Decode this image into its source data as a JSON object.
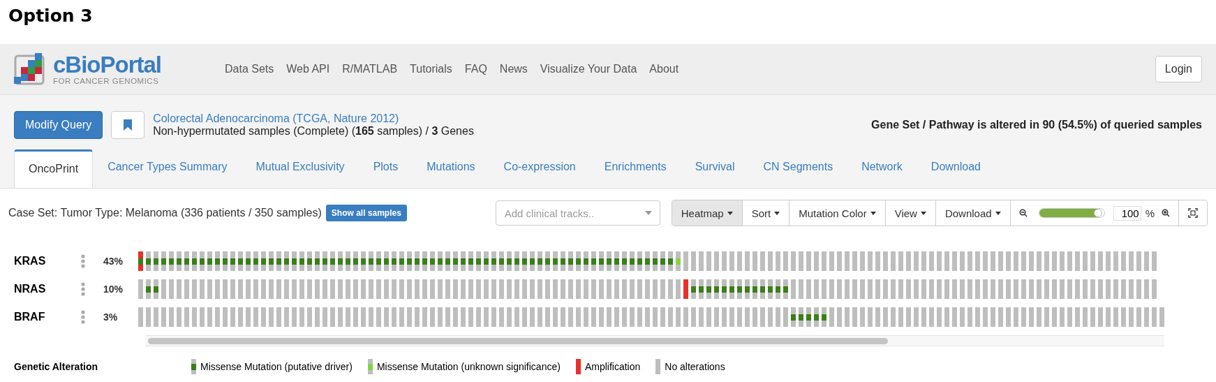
{
  "heading": "Option 3",
  "navbar": {
    "logo": {
      "name": "cBioPortal",
      "tagline": "FOR CANCER GENOMICS"
    },
    "links": [
      "Data Sets",
      "Web API",
      "R/MATLAB",
      "Tutorials",
      "FAQ",
      "News",
      "Visualize Your Data",
      "About"
    ],
    "login": "Login"
  },
  "query": {
    "modify_button": "Modify Query",
    "study": "Colorectal Adenocarcinoma (TCGA, Nature 2012)",
    "description": "Non-hypermutated samples (Complete)  (**165** samples) / **3** Genes",
    "summary": "Gene Set / Pathway is altered in 90 (54.5%) of queried samples"
  },
  "tabs": [
    {
      "label": "OncoPrint",
      "selected": true
    },
    {
      "label": "Cancer Types Summary",
      "selected": false
    },
    {
      "label": "Mutual Exclusivity",
      "selected": false
    },
    {
      "label": "Plots",
      "selected": false
    },
    {
      "label": "Mutations",
      "selected": false
    },
    {
      "label": "Co-expression",
      "selected": false
    },
    {
      "label": "Enrichments",
      "selected": false
    },
    {
      "label": "Survival",
      "selected": false
    },
    {
      "label": "CN Segments",
      "selected": false
    },
    {
      "label": "Network",
      "selected": false
    },
    {
      "label": "Download",
      "selected": false
    }
  ],
  "toolbar": {
    "case_set": "Case Set: Tumor Type: Melanoma (336 patients / 350 samples)",
    "show_all": "Show all samples",
    "clinical_tracks": {
      "placeholder": "Add clinical tracks.."
    },
    "menus": [
      "Heatmap",
      "Sort",
      "Mutation Color",
      "View",
      "Download"
    ],
    "zoom": {
      "level": 0.95,
      "value": "100",
      "unit": "%"
    }
  },
  "tracks": [
    {
      "gene": "KRAS",
      "percent": "43%",
      "cells": [
        {
          "kind": "ampdriver"
        },
        {
          "kind": "driver"
        },
        {
          "kind": "driver"
        },
        {
          "kind": "driver"
        },
        {
          "kind": "driver"
        },
        {
          "kind": "driver"
        },
        {
          "kind": "driver"
        },
        {
          "kind": "driver"
        },
        {
          "kind": "driver"
        },
        {
          "kind": "driver"
        },
        {
          "kind": "driver"
        },
        {
          "kind": "driver"
        },
        {
          "kind": "driver"
        },
        {
          "kind": "driver"
        },
        {
          "kind": "driver"
        },
        {
          "kind": "driver"
        },
        {
          "kind": "driver"
        },
        {
          "kind": "driver"
        },
        {
          "kind": "driver"
        },
        {
          "kind": "driver"
        },
        {
          "kind": "driver"
        },
        {
          "kind": "driver"
        },
        {
          "kind": "driver"
        },
        {
          "kind": "driver"
        },
        {
          "kind": "driver"
        },
        {
          "kind": "driver"
        },
        {
          "kind": "driver"
        },
        {
          "kind": "driver"
        },
        {
          "kind": "driver"
        },
        {
          "kind": "driver"
        },
        {
          "kind": "driver"
        },
        {
          "kind": "driver"
        },
        {
          "kind": "driver"
        },
        {
          "kind": "driver"
        },
        {
          "kind": "driver"
        },
        {
          "kind": "driver"
        },
        {
          "kind": "driver"
        },
        {
          "kind": "driver"
        },
        {
          "kind": "driver"
        },
        {
          "kind": "driver"
        },
        {
          "kind": "driver"
        },
        {
          "kind": "driver"
        },
        {
          "kind": "driver"
        },
        {
          "kind": "driver"
        },
        {
          "kind": "driver"
        },
        {
          "kind": "driver"
        },
        {
          "kind": "driver"
        },
        {
          "kind": "driver"
        },
        {
          "kind": "driver"
        },
        {
          "kind": "driver"
        },
        {
          "kind": "driver"
        },
        {
          "kind": "driver"
        },
        {
          "kind": "driver"
        },
        {
          "kind": "driver"
        },
        {
          "kind": "driver"
        },
        {
          "kind": "driver"
        },
        {
          "kind": "driver"
        },
        {
          "kind": "driver"
        },
        {
          "kind": "driver"
        },
        {
          "kind": "driver"
        },
        {
          "kind": "driver"
        },
        {
          "kind": "driver"
        },
        {
          "kind": "driver"
        },
        {
          "kind": "driver"
        },
        {
          "kind": "driver"
        },
        {
          "kind": "driver"
        },
        {
          "kind": "driver"
        },
        {
          "kind": "driver"
        },
        {
          "kind": "driver"
        },
        {
          "kind": "driver"
        },
        {
          "kind": "vus"
        },
        {
          "kind": "none"
        },
        {
          "kind": "none"
        },
        {
          "kind": "none"
        },
        {
          "kind": "none"
        },
        {
          "kind": "none"
        },
        {
          "kind": "none"
        },
        {
          "kind": "none"
        },
        {
          "kind": "none"
        },
        {
          "kind": "none"
        },
        {
          "kind": "none"
        },
        {
          "kind": "none"
        },
        {
          "kind": "none"
        },
        {
          "kind": "none"
        },
        {
          "kind": "none"
        },
        {
          "kind": "none"
        },
        {
          "kind": "none"
        },
        {
          "kind": "none"
        },
        {
          "kind": "none"
        },
        {
          "kind": "none"
        },
        {
          "kind": "none"
        },
        {
          "kind": "none"
        },
        {
          "kind": "none"
        },
        {
          "kind": "none"
        },
        {
          "kind": "none"
        },
        {
          "kind": "none"
        },
        {
          "kind": "none"
        },
        {
          "kind": "none"
        },
        {
          "kind": "none"
        },
        {
          "kind": "none"
        },
        {
          "kind": "none"
        },
        {
          "kind": "none"
        },
        {
          "kind": "none"
        },
        {
          "kind": "none"
        },
        {
          "kind": "none"
        },
        {
          "kind": "none"
        },
        {
          "kind": "none"
        },
        {
          "kind": "none"
        },
        {
          "kind": "none"
        },
        {
          "kind": "none"
        },
        {
          "kind": "none"
        },
        {
          "kind": "none"
        },
        {
          "kind": "none"
        },
        {
          "kind": "none"
        },
        {
          "kind": "none"
        },
        {
          "kind": "none"
        },
        {
          "kind": "none"
        },
        {
          "kind": "none"
        },
        {
          "kind": "none"
        },
        {
          "kind": "none"
        },
        {
          "kind": "none"
        },
        {
          "kind": "none"
        },
        {
          "kind": "none"
        },
        {
          "kind": "none"
        },
        {
          "kind": "none"
        },
        {
          "kind": "none"
        },
        {
          "kind": "none"
        },
        {
          "kind": "none"
        },
        {
          "kind": "none"
        },
        {
          "kind": "none"
        },
        {
          "kind": "none"
        },
        {
          "kind": "none"
        },
        {
          "kind": "none"
        }
      ]
    },
    {
      "gene": "NRAS",
      "percent": "10%",
      "cells": [
        {
          "kind": "none"
        },
        {
          "kind": "driver"
        },
        {
          "kind": "driver"
        },
        {
          "kind": "none"
        },
        {
          "kind": "none"
        },
        {
          "kind": "none"
        },
        {
          "kind": "none"
        },
        {
          "kind": "none"
        },
        {
          "kind": "none"
        },
        {
          "kind": "none"
        },
        {
          "kind": "none"
        },
        {
          "kind": "none"
        },
        {
          "kind": "none"
        },
        {
          "kind": "none"
        },
        {
          "kind": "none"
        },
        {
          "kind": "none"
        },
        {
          "kind": "none"
        },
        {
          "kind": "none"
        },
        {
          "kind": "none"
        },
        {
          "kind": "none"
        },
        {
          "kind": "none"
        },
        {
          "kind": "none"
        },
        {
          "kind": "none"
        },
        {
          "kind": "none"
        },
        {
          "kind": "none"
        },
        {
          "kind": "none"
        },
        {
          "kind": "none"
        },
        {
          "kind": "none"
        },
        {
          "kind": "none"
        },
        {
          "kind": "none"
        },
        {
          "kind": "none"
        },
        {
          "kind": "none"
        },
        {
          "kind": "none"
        },
        {
          "kind": "none"
        },
        {
          "kind": "none"
        },
        {
          "kind": "none"
        },
        {
          "kind": "none"
        },
        {
          "kind": "none"
        },
        {
          "kind": "none"
        },
        {
          "kind": "none"
        },
        {
          "kind": "none"
        },
        {
          "kind": "none"
        },
        {
          "kind": "none"
        },
        {
          "kind": "none"
        },
        {
          "kind": "none"
        },
        {
          "kind": "none"
        },
        {
          "kind": "none"
        },
        {
          "kind": "none"
        },
        {
          "kind": "none"
        },
        {
          "kind": "none"
        },
        {
          "kind": "none"
        },
        {
          "kind": "none"
        },
        {
          "kind": "none"
        },
        {
          "kind": "none"
        },
        {
          "kind": "none"
        },
        {
          "kind": "none"
        },
        {
          "kind": "none"
        },
        {
          "kind": "none"
        },
        {
          "kind": "none"
        },
        {
          "kind": "none"
        },
        {
          "kind": "none"
        },
        {
          "kind": "none"
        },
        {
          "kind": "none"
        },
        {
          "kind": "none"
        },
        {
          "kind": "none"
        },
        {
          "kind": "none"
        },
        {
          "kind": "none"
        },
        {
          "kind": "none"
        },
        {
          "kind": "none"
        },
        {
          "kind": "none"
        },
        {
          "kind": "none"
        },
        {
          "kind": "amp"
        },
        {
          "kind": "driver"
        },
        {
          "kind": "driver"
        },
        {
          "kind": "driver"
        },
        {
          "kind": "driver"
        },
        {
          "kind": "driver"
        },
        {
          "kind": "driver"
        },
        {
          "kind": "driver"
        },
        {
          "kind": "driver"
        },
        {
          "kind": "driver"
        },
        {
          "kind": "driver"
        },
        {
          "kind": "driver"
        },
        {
          "kind": "driver"
        },
        {
          "kind": "driver"
        },
        {
          "kind": "none"
        },
        {
          "kind": "none"
        },
        {
          "kind": "none"
        },
        {
          "kind": "none"
        },
        {
          "kind": "none"
        },
        {
          "kind": "none"
        },
        {
          "kind": "none"
        },
        {
          "kind": "none"
        },
        {
          "kind": "none"
        },
        {
          "kind": "none"
        },
        {
          "kind": "none"
        },
        {
          "kind": "none"
        },
        {
          "kind": "none"
        },
        {
          "kind": "none"
        },
        {
          "kind": "none"
        },
        {
          "kind": "none"
        },
        {
          "kind": "none"
        },
        {
          "kind": "none"
        },
        {
          "kind": "none"
        },
        {
          "kind": "none"
        },
        {
          "kind": "none"
        },
        {
          "kind": "none"
        },
        {
          "kind": "none"
        },
        {
          "kind": "none"
        },
        {
          "kind": "none"
        },
        {
          "kind": "none"
        },
        {
          "kind": "none"
        },
        {
          "kind": "none"
        },
        {
          "kind": "none"
        },
        {
          "kind": "none"
        },
        {
          "kind": "none"
        },
        {
          "kind": "none"
        },
        {
          "kind": "none"
        },
        {
          "kind": "none"
        },
        {
          "kind": "none"
        },
        {
          "kind": "none"
        },
        {
          "kind": "none"
        },
        {
          "kind": "none"
        },
        {
          "kind": "none"
        },
        {
          "kind": "none"
        },
        {
          "kind": "none"
        },
        {
          "kind": "none"
        },
        {
          "kind": "none"
        },
        {
          "kind": "none"
        },
        {
          "kind": "none"
        },
        {
          "kind": "none"
        },
        {
          "kind": "none"
        },
        {
          "kind": "none"
        }
      ]
    },
    {
      "gene": "BRAF",
      "percent": "3%",
      "cells": [
        {
          "kind": "none"
        },
        {
          "kind": "none"
        },
        {
          "kind": "none"
        },
        {
          "kind": "none"
        },
        {
          "kind": "none"
        },
        {
          "kind": "none"
        },
        {
          "kind": "none"
        },
        {
          "kind": "none"
        },
        {
          "kind": "none"
        },
        {
          "kind": "none"
        },
        {
          "kind": "none"
        },
        {
          "kind": "none"
        },
        {
          "kind": "none"
        },
        {
          "kind": "none"
        },
        {
          "kind": "none"
        },
        {
          "kind": "none"
        },
        {
          "kind": "none"
        },
        {
          "kind": "none"
        },
        {
          "kind": "none"
        },
        {
          "kind": "none"
        },
        {
          "kind": "none"
        },
        {
          "kind": "none"
        },
        {
          "kind": "none"
        },
        {
          "kind": "none"
        },
        {
          "kind": "none"
        },
        {
          "kind": "none"
        },
        {
          "kind": "none"
        },
        {
          "kind": "none"
        },
        {
          "kind": "none"
        },
        {
          "kind": "none"
        },
        {
          "kind": "none"
        },
        {
          "kind": "none"
        },
        {
          "kind": "none"
        },
        {
          "kind": "none"
        },
        {
          "kind": "none"
        },
        {
          "kind": "none"
        },
        {
          "kind": "none"
        },
        {
          "kind": "none"
        },
        {
          "kind": "none"
        },
        {
          "kind": "none"
        },
        {
          "kind": "none"
        },
        {
          "kind": "none"
        },
        {
          "kind": "none"
        },
        {
          "kind": "none"
        },
        {
          "kind": "none"
        },
        {
          "kind": "none"
        },
        {
          "kind": "none"
        },
        {
          "kind": "none"
        },
        {
          "kind": "none"
        },
        {
          "kind": "none"
        },
        {
          "kind": "none"
        },
        {
          "kind": "none"
        },
        {
          "kind": "none"
        },
        {
          "kind": "none"
        },
        {
          "kind": "none"
        },
        {
          "kind": "none"
        },
        {
          "kind": "none"
        },
        {
          "kind": "none"
        },
        {
          "kind": "none"
        },
        {
          "kind": "none"
        },
        {
          "kind": "none"
        },
        {
          "kind": "none"
        },
        {
          "kind": "none"
        },
        {
          "kind": "none"
        },
        {
          "kind": "none"
        },
        {
          "kind": "none"
        },
        {
          "kind": "none"
        },
        {
          "kind": "none"
        },
        {
          "kind": "none"
        },
        {
          "kind": "none"
        },
        {
          "kind": "none"
        },
        {
          "kind": "none"
        },
        {
          "kind": "none"
        },
        {
          "kind": "none"
        },
        {
          "kind": "none"
        },
        {
          "kind": "none"
        },
        {
          "kind": "none"
        },
        {
          "kind": "none"
        },
        {
          "kind": "none"
        },
        {
          "kind": "none"
        },
        {
          "kind": "none"
        },
        {
          "kind": "none"
        },
        {
          "kind": "none"
        },
        {
          "kind": "none"
        },
        {
          "kind": "none"
        },
        {
          "kind": "driver"
        },
        {
          "kind": "driver"
        },
        {
          "kind": "driver"
        },
        {
          "kind": "driver"
        },
        {
          "kind": "driver"
        },
        {
          "kind": "none"
        },
        {
          "kind": "none"
        },
        {
          "kind": "none"
        },
        {
          "kind": "none"
        },
        {
          "kind": "none"
        },
        {
          "kind": "none"
        },
        {
          "kind": "none"
        },
        {
          "kind": "none"
        },
        {
          "kind": "none"
        },
        {
          "kind": "none"
        },
        {
          "kind": "none"
        },
        {
          "kind": "none"
        },
        {
          "kind": "none"
        },
        {
          "kind": "none"
        },
        {
          "kind": "none"
        },
        {
          "kind": "none"
        },
        {
          "kind": "none"
        },
        {
          "kind": "none"
        },
        {
          "kind": "none"
        },
        {
          "kind": "none"
        },
        {
          "kind": "none"
        },
        {
          "kind": "none"
        },
        {
          "kind": "none"
        },
        {
          "kind": "none"
        },
        {
          "kind": "none"
        },
        {
          "kind": "none"
        },
        {
          "kind": "none"
        },
        {
          "kind": "none"
        },
        {
          "kind": "none"
        },
        {
          "kind": "none"
        },
        {
          "kind": "none"
        },
        {
          "kind": "none"
        },
        {
          "kind": "none"
        },
        {
          "kind": "none"
        },
        {
          "kind": "none"
        },
        {
          "kind": "none"
        },
        {
          "kind": "none"
        },
        {
          "kind": "none"
        },
        {
          "kind": "none"
        },
        {
          "kind": "none"
        },
        {
          "kind": "none"
        },
        {
          "kind": "none"
        },
        {
          "kind": "none"
        },
        {
          "kind": "none"
        }
      ]
    }
  ],
  "legend": {
    "title": "Genetic Alteration",
    "items": [
      {
        "kind": "driver",
        "label": "Missense Mutation (putative driver)"
      },
      {
        "kind": "vus",
        "label": "Missense Mutation (unknown significance)"
      },
      {
        "kind": "amp",
        "label": "Amplification"
      },
      {
        "kind": "none",
        "label": "No alterations"
      }
    ]
  }
}
